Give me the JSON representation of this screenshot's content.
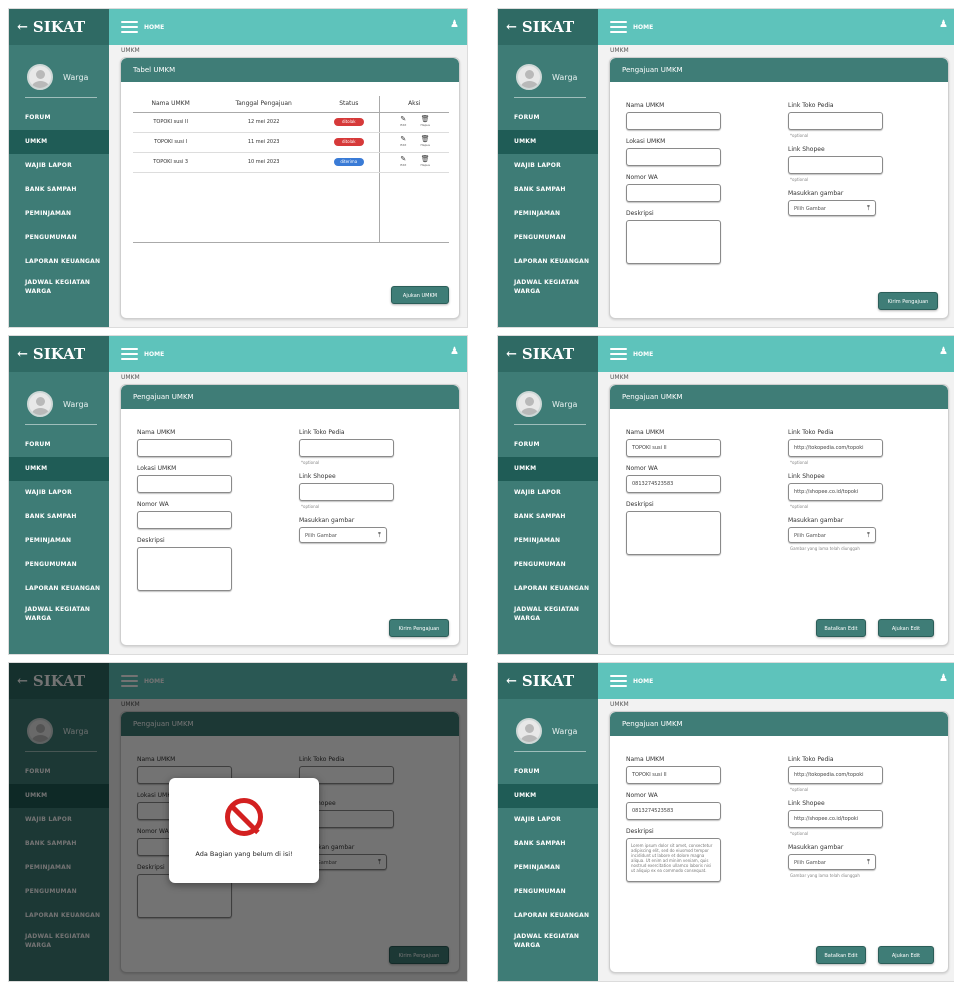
{
  "app": {
    "brand": "SIKAT",
    "back_arrow": "←",
    "home_label": "HOME",
    "bell_icon": "bell-icon",
    "username": "Warga",
    "breadcrumb": "UMKM",
    "colors": {
      "sidebar": "#3e7c76",
      "topbar": "#5ec3bb",
      "card_header": "#3f7d77",
      "badge_red": "#d63a3a",
      "badge_blue": "#3a7bd6"
    }
  },
  "menu": [
    "FORUM",
    "UMKM",
    "WAJIB LAPOR",
    "BANK SAMPAH",
    "PEMINJAMAN",
    "PENGUMUMAN",
    "LAPORAN KEUANGAN",
    "JADWAL KEGIATAN WARGA"
  ],
  "active_menu": "UMKM",
  "table_panel": {
    "card_title": "Tabel UMKM",
    "columns": [
      "Nama UMKM",
      "Tanggal Pengajuan",
      "Status",
      "Aksi"
    ],
    "rows": [
      {
        "name": "TOPOKI susi II",
        "date": "12 mei 2022",
        "status": "ditolak",
        "status_color": "#d63a3a"
      },
      {
        "name": "TOPOKI susi I",
        "date": "11 mei 2023",
        "status": "ditolak",
        "status_color": "#d63a3a"
      },
      {
        "name": "TOPOKI susi 3",
        "date": "10 mei 2023",
        "status": "diterima",
        "status_color": "#3a7bd6"
      }
    ],
    "action_edit": "Edit",
    "action_delete": "Hapus",
    "edit_icon": "edit-icon",
    "delete_icon": "trash-icon",
    "button": "Ajukan UMKM"
  },
  "form": {
    "card_title": "Pengajuan UMKM",
    "name_label": "Nama UMKM",
    "location_label": "Lokasi UMKM",
    "wa_label": "Nomor WA",
    "desc_label": "Deskripsi",
    "tokopedia_label": "Link Toko Pedia",
    "shopee_label": "Link Shopee",
    "image_label": "Masukkan gambar",
    "file_placeholder": "Pilih Gambar",
    "optional_hint": "*optional",
    "upload_icon": "upload-icon",
    "submit_button": "Kirim Pengajuan",
    "cancel_edit_button": "Batalkan Edit",
    "save_edit_button": "Ajukan Edit"
  },
  "filled_form": {
    "name_value": "TOPOKI susi II",
    "wa_value": "0813274523583",
    "tokopedia_value": "http://tokopedia.com/topoki",
    "shopee_value": "http://shopee.co.id/topoki",
    "file_hint": "Gambar yang lama telah diunggah",
    "desc_value": "Lorem ipsum dolor sit amet, consectetur adipiscing elit, sed do eiusmod tempor incididunt ut labore et dolore magna aliqua. Ut enim ad minim veniam, quis nostrud exercitation ullamco laboris nisi ut aliquip ex ea commodo consequat."
  },
  "alert": {
    "icon": "prohibited-icon",
    "message": "Ada Bagian yang belum di isi!"
  }
}
